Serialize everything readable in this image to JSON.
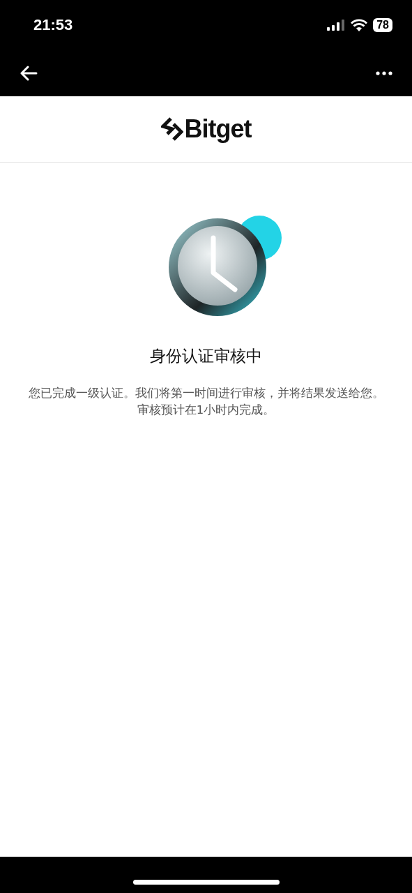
{
  "status_bar": {
    "time": "21:53",
    "battery": "78"
  },
  "brand": {
    "name": "Bitget"
  },
  "status": {
    "title": "身份认证审核中",
    "message": "您已完成一级认证。我们将第一时间进行审核，并将结果发送给您。审核预计在1小时内完成。"
  }
}
